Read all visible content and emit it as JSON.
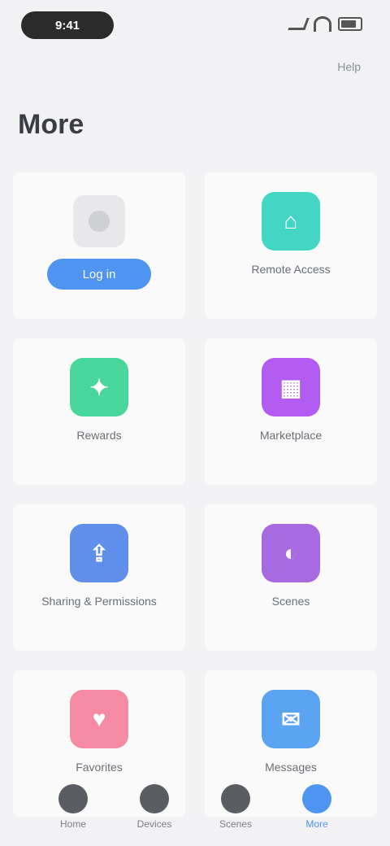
{
  "status": {
    "time": "9:41"
  },
  "header": {
    "top_link": "Help",
    "title": "More"
  },
  "cards": [
    {
      "type": "login",
      "button_label": "Log in"
    },
    {
      "label": "Remote Access",
      "icon": "remote-icon",
      "color": "#43d6c4"
    },
    {
      "label": "Rewards",
      "icon": "gift-icon",
      "color": "#49d69b"
    },
    {
      "label": "Marketplace",
      "icon": "store-icon",
      "color": "#b25cf2"
    },
    {
      "label": "Sharing & Permissions",
      "icon": "share-icon",
      "color": "#5f8fe8"
    },
    {
      "label": "Scenes",
      "icon": "scene-icon",
      "color": "#a86ae0"
    },
    {
      "label": "Favorites",
      "icon": "heart-icon",
      "color": "#f58aa3"
    },
    {
      "label": "Messages",
      "icon": "message-icon",
      "color": "#5aa4f2"
    }
  ],
  "tabs": [
    {
      "label": "Home",
      "icon": "home-icon",
      "active": false
    },
    {
      "label": "Devices",
      "icon": "devices-icon",
      "active": false
    },
    {
      "label": "Scenes",
      "icon": "scenes-icon",
      "active": false
    },
    {
      "label": "More",
      "icon": "more-icon",
      "active": true
    }
  ]
}
